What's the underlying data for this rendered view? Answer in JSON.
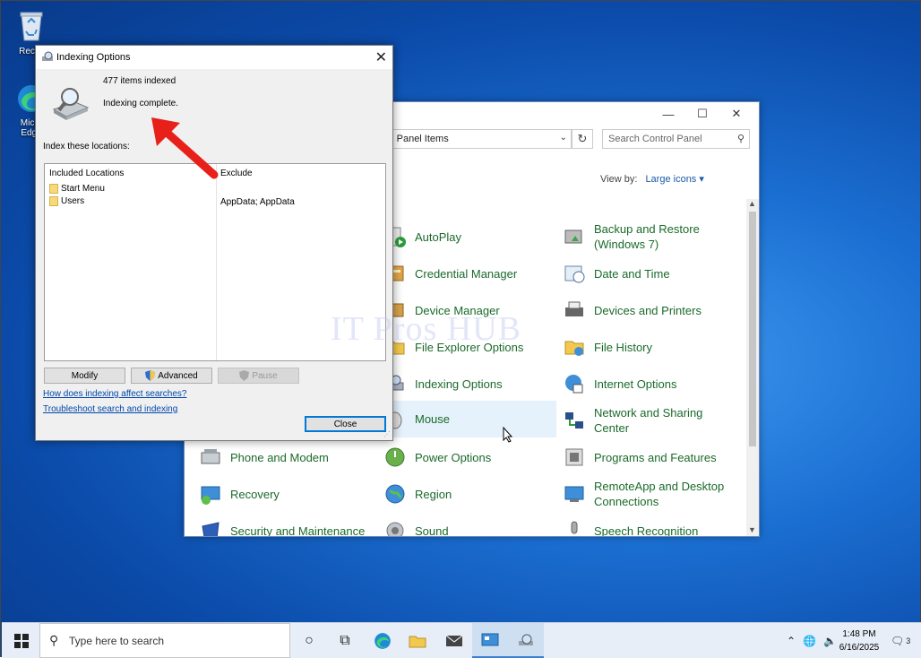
{
  "desktop": {
    "icons": [
      {
        "label": "Recycle Bin",
        "visible": "Recyc"
      },
      {
        "label": "Microsoft Edge",
        "visible1": "Micro",
        "visible2": "Edge"
      }
    ]
  },
  "control_panel": {
    "address": "ol Panel Items",
    "search_placeholder": "Search Control Panel",
    "view_by_label": "View by:",
    "view_by_value": "Large icons",
    "items": [
      {
        "label": "AutoPlay",
        "icon": "autoplay-icon"
      },
      {
        "label": "Backup and Restore (Windows 7)",
        "icon": "backup-icon"
      },
      {
        "label": "Credential Manager",
        "icon": "credential-icon"
      },
      {
        "label": "Date and Time",
        "icon": "clock-icon"
      },
      {
        "label": "Device Manager",
        "icon": "device-manager-icon"
      },
      {
        "label": "Devices and Printers",
        "icon": "printer-icon"
      },
      {
        "label": "File Explorer Options",
        "icon": "folder-options-icon"
      },
      {
        "label": "File History",
        "icon": "file-history-icon"
      },
      {
        "label": "Indexing Options",
        "icon": "indexing-icon"
      },
      {
        "label": "Internet Options",
        "icon": "internet-icon"
      },
      {
        "label": "Mouse",
        "icon": "mouse-icon"
      },
      {
        "label": "Network and Sharing Center",
        "icon": "network-icon"
      },
      {
        "label": "Phone and Modem",
        "icon": "phone-icon"
      },
      {
        "label": "Power Options",
        "icon": "power-icon"
      },
      {
        "label": "Programs and Features",
        "icon": "programs-icon"
      },
      {
        "label": "Recovery",
        "icon": "recovery-icon"
      },
      {
        "label": "Region",
        "icon": "region-icon"
      },
      {
        "label": "RemoteApp and Desktop Connections",
        "icon": "remoteapp-icon"
      },
      {
        "label": "Security and Maintenance",
        "icon": "security-icon"
      },
      {
        "label": "Sound",
        "icon": "sound-icon"
      },
      {
        "label": "Speech Recognition",
        "icon": "speech-icon"
      }
    ],
    "text": {
      "backup_1": "Backup and Restore",
      "backup_2": "(Windows 7)",
      "network_1": "Network and Sharing",
      "network_2": "Center",
      "remote_1": "RemoteApp and Desktop",
      "remote_2": "Connections"
    }
  },
  "indexing_dialog": {
    "title": "Indexing Options",
    "items_indexed": "477 items indexed",
    "status": "Indexing complete.",
    "locations_label": "Index these locations:",
    "col_included": "Included Locations",
    "col_exclude": "Exclude",
    "locations": [
      {
        "name": "Start Menu",
        "exclude": ""
      },
      {
        "name": "Users",
        "exclude": "AppData; AppData"
      }
    ],
    "buttons": {
      "modify": "Modify",
      "advanced": "Advanced",
      "pause": "Pause",
      "close": "Close"
    },
    "links": {
      "affect": "How does indexing affect searches?",
      "troubleshoot": "Troubleshoot search and indexing"
    }
  },
  "watermark": "IT Pros HUB",
  "taskbar": {
    "search_placeholder": "Type here to search",
    "time": "1:48 PM",
    "date": "6/16/2025",
    "notifications": "3"
  },
  "colors": {
    "link": "#0047ab",
    "cp_item": "#1a6a2a",
    "accent": "#0078d7",
    "arrow": "#e8201a"
  }
}
